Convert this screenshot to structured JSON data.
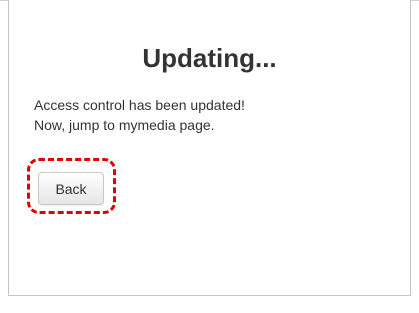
{
  "dialog": {
    "title": "Updating...",
    "message_line1": "Access control has been updated!",
    "message_line2": "Now, jump to mymedia page.",
    "back_button_label": "Back"
  },
  "colors": {
    "highlight_border": "#e00000",
    "text": "#333333",
    "dialog_border": "#c4c4c4"
  }
}
